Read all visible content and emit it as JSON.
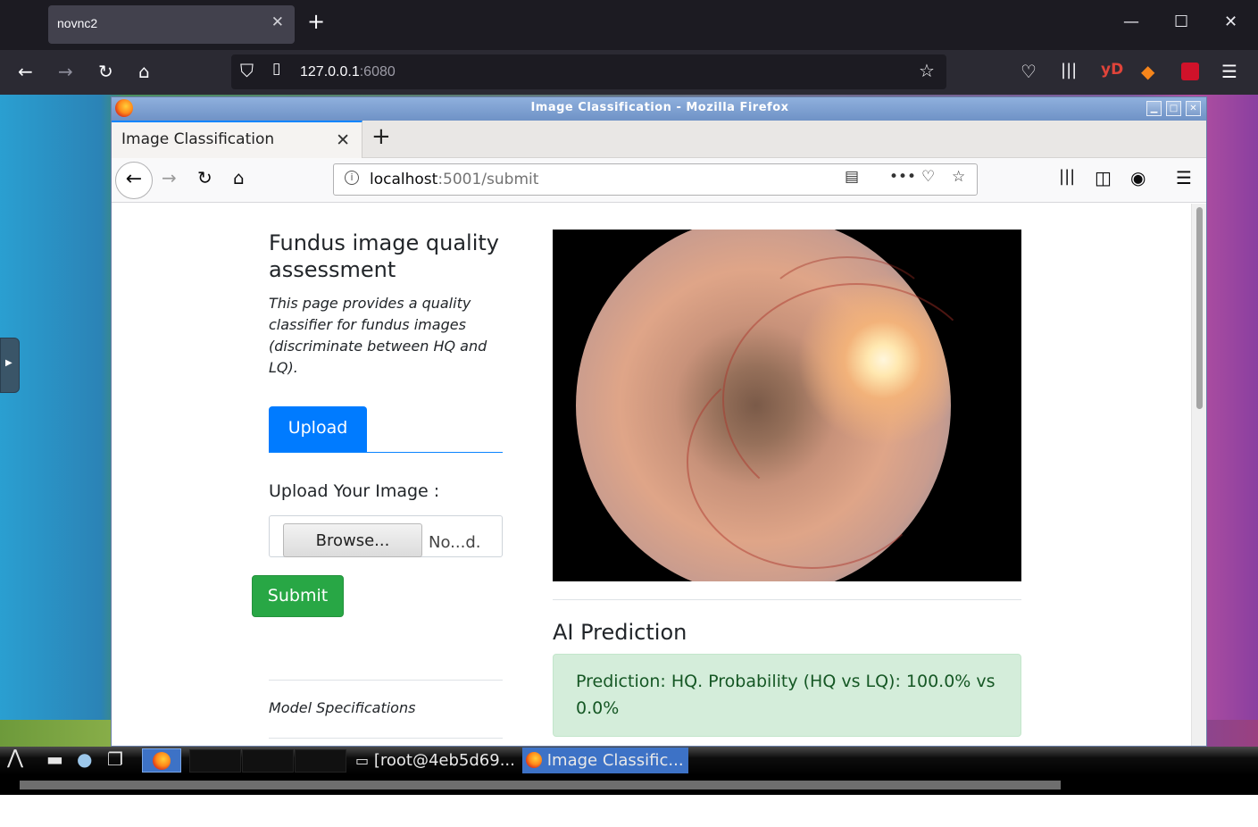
{
  "outer_browser": {
    "tab_title": "novnc2",
    "url_host": "127.0.0.1",
    "url_port": ":6080",
    "icons": [
      "back-icon",
      "forward-icon",
      "reload-icon",
      "home-icon",
      "shield-icon",
      "page-icon",
      "star-icon",
      "pocket-icon",
      "library-icon",
      "yandex-icon",
      "metamask-icon",
      "extension-icon",
      "menu-icon"
    ],
    "yD_label": "yD"
  },
  "inner_window": {
    "title": "Image Classification - Mozilla Firefox",
    "tab_title": "Image Classification",
    "url_host": "localhost",
    "url_path": ":5001/submit"
  },
  "page": {
    "heading": "Fundus image quality assessment",
    "description": "This page provides a quality classifier for fundus images (discriminate between HQ and LQ).",
    "upload_tab": "Upload",
    "upload_label": "Upload Your Image :",
    "browse_button": "Browse...",
    "file_name": "No...d.",
    "submit_button": "Submit",
    "model_specs": "Model Specifications",
    "ai_prediction_title": "AI Prediction",
    "prediction_text": "Prediction: HQ. Probability (HQ vs LQ): 100.0% vs 0.0%"
  },
  "taskbar": {
    "task_terminal": "[root@4eb5d69...",
    "task_firefox": "Image Classific..."
  },
  "colors": {
    "primary_button": "#007bff",
    "submit_button": "#28a745",
    "alert_bg": "#d4edda",
    "alert_text": "#155724"
  }
}
